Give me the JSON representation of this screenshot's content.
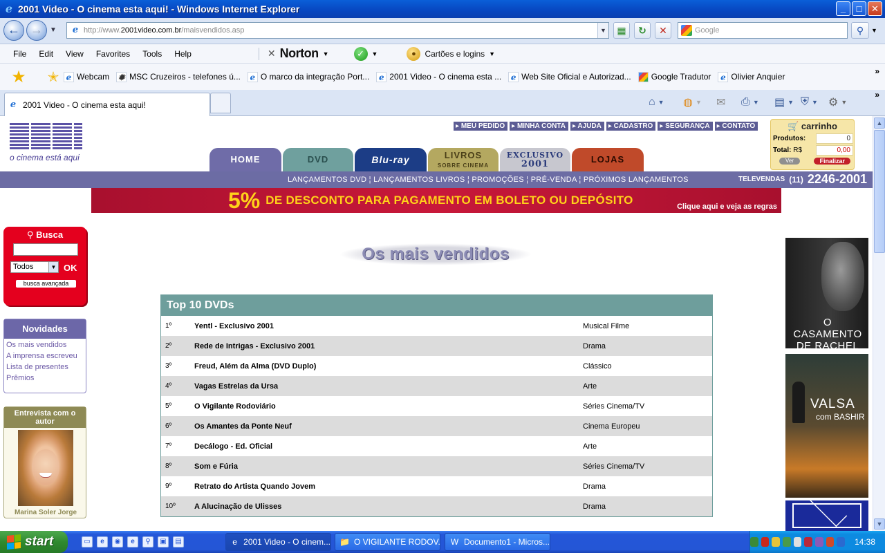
{
  "window": {
    "title": "2001 Video - O cinema esta aqui! - Windows Internet Explorer",
    "minimize": "_",
    "maximize": "□",
    "close": "✕"
  },
  "address": {
    "url_prefix": "http://www.",
    "url_domain": "2001video.com.br",
    "url_path": "/maisvendidos.asp",
    "search_placeholder": "Google"
  },
  "menu": {
    "items": [
      "File",
      "Edit",
      "View",
      "Favorites",
      "Tools",
      "Help"
    ],
    "norton_label": "Norton",
    "cartoes_label": "Cartões e logins"
  },
  "favorites": {
    "items": [
      "Webcam",
      "MSC Cruzeiros - telefones ú...",
      "O marco da integração Port...",
      "2001 Video - O cinema esta ...",
      "Web Site Oficial e Autorizad...",
      "Google Tradutor",
      "Olivier Anquier"
    ],
    "more": "»"
  },
  "tabs": {
    "active_label": "2001 Video - O cinema esta aqui!"
  },
  "site": {
    "logo_tagline": "o cinema está aqui",
    "top_links": [
      "MEU PEDIDO",
      "MINHA CONTA",
      "AJUDA",
      "CADASTRO",
      "SEGURANÇA",
      "CONTATO"
    ],
    "nav_tabs": {
      "home": "HOME",
      "dvd": "DVD",
      "bluray": "Blu-ray",
      "livros": "LIVROS",
      "livros_sub": "SOBRE CINEMA",
      "exclusivo": "EXCLUSIVO",
      "exclusivo_sub": "2001",
      "lojas": "LOJAS"
    },
    "cart": {
      "title": "carrinho",
      "produtos_label": "Produtos:",
      "produtos_value": "0",
      "total_label": "Total:",
      "currency": "R$",
      "total_value": "0,00",
      "ver_label": "Ver",
      "finalizar_label": "Finalizar"
    },
    "sub_links": "LANÇAMENTOS DVD  ¦  LANÇAMENTOS LIVROS  ¦  PROMOÇÕES  ¦  PRÉ-VENDA  ¦  PRÓXIMOS LANÇAMENTOS",
    "televendas_label": "TELEVENDAS",
    "televendas_ddd": "(11)",
    "televendas_num": "2246-2001",
    "promo": {
      "percent": "5%",
      "text": "DE DESCONTO PARA PAGAMENTO EM BOLETO OU DEPÓSITO",
      "cta": "Clique aqui e veja as regras"
    },
    "busca": {
      "title": "Busca",
      "select_value": "Todos",
      "ok_label": "OK",
      "advanced_label": "busca avançada"
    },
    "novidades": {
      "title": "Novidades",
      "links": [
        "Os mais vendidos",
        "A imprensa escreveu",
        "Lista de presentes",
        "Prêmios"
      ]
    },
    "entrevista": {
      "title": "Entrevista com o autor",
      "name": "Marina Soler Jorge"
    },
    "page_heading": "Os mais vendidos",
    "top10": {
      "header": "Top 10 DVDs",
      "rows": [
        {
          "rank": "1º",
          "title": "Yentl - Exclusivo 2001",
          "genre": "Musical Filme"
        },
        {
          "rank": "2º",
          "title": "Rede de Intrigas - Exclusivo 2001",
          "genre": "Drama"
        },
        {
          "rank": "3º",
          "title": "Freud, Além da Alma (DVD Duplo)",
          "genre": "Clássico"
        },
        {
          "rank": "4º",
          "title": "Vagas Estrelas da Ursa",
          "genre": "Arte"
        },
        {
          "rank": "5º",
          "title": "O Vigilante Rodoviário",
          "genre": "Séries Cinema/TV"
        },
        {
          "rank": "6º",
          "title": "Os Amantes da Ponte Neuf",
          "genre": "Cinema Europeu"
        },
        {
          "rank": "7º",
          "title": "Decálogo - Ed. Oficial",
          "genre": "Arte"
        },
        {
          "rank": "8º",
          "title": "Som e Fúria",
          "genre": "Séries Cinema/TV"
        },
        {
          "rank": "9º",
          "title": "Retrato do Artista Quando Jovem",
          "genre": "Drama"
        },
        {
          "rank": "10º",
          "title": "A Alucinação de Ulisses",
          "genre": "Drama"
        }
      ]
    },
    "poster1_title": "O CASAMENTO DE RACHEL",
    "poster2_title": "VALSA",
    "poster2_sub": "com BASHIR"
  },
  "taskbar": {
    "start_label": "start",
    "tasks": [
      "2001 Video - O cinem...",
      "O VIGILANTE RODOV...",
      "Documento1 - Micros..."
    ],
    "clock": "14:38"
  }
}
